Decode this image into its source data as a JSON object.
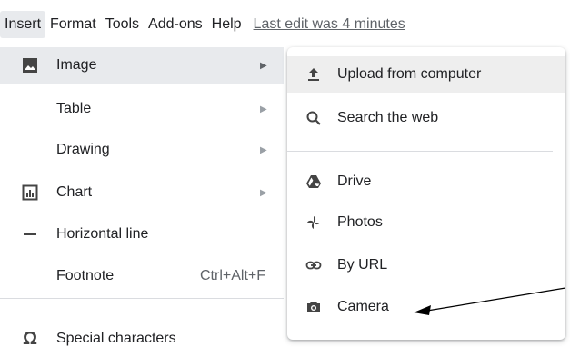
{
  "menubar": {
    "items": [
      "Insert",
      "Format",
      "Tools",
      "Add-ons",
      "Help"
    ],
    "last_edit": "Last edit was 4 minutes"
  },
  "insert_menu": {
    "items": [
      {
        "label": "Image",
        "icon": "image-icon",
        "has_submenu": true
      },
      {
        "label": "Table",
        "icon": "",
        "has_submenu": true
      },
      {
        "label": "Drawing",
        "icon": "",
        "has_submenu": true
      },
      {
        "label": "Chart",
        "icon": "chart-icon",
        "has_submenu": true
      },
      {
        "label": "Horizontal line",
        "icon": "horizontal-line-icon",
        "has_submenu": false
      },
      {
        "label": "Footnote",
        "icon": "",
        "shortcut": "Ctrl+Alt+F",
        "has_submenu": false
      },
      {
        "label": "Special characters",
        "icon": "omega-icon",
        "has_submenu": false
      }
    ]
  },
  "image_submenu": {
    "items": [
      {
        "label": "Upload from computer",
        "icon": "upload-icon"
      },
      {
        "label": "Search the web",
        "icon": "search-icon"
      },
      {
        "label": "Drive",
        "icon": "drive-icon"
      },
      {
        "label": "Photos",
        "icon": "photos-icon"
      },
      {
        "label": "By URL",
        "icon": "link-icon"
      },
      {
        "label": "Camera",
        "icon": "camera-icon"
      }
    ]
  },
  "background": {
    "right_stub": "U"
  },
  "colors": {
    "highlight": "#e8eaed",
    "text": "#202124",
    "muted": "#5f6368",
    "annotation": "#000000"
  }
}
